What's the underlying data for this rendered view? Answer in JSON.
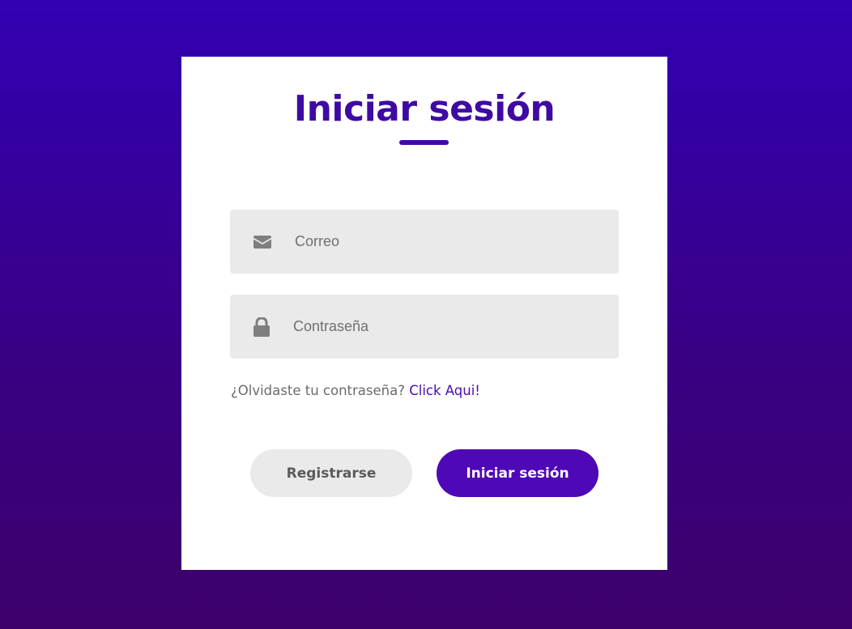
{
  "card": {
    "title": "Iniciar sesión",
    "email": {
      "placeholder": "Correo",
      "icon": "envelope-icon"
    },
    "password": {
      "placeholder": "Contraseña",
      "icon": "lock-icon"
    },
    "forgot": {
      "text": "¿Olvidaste tu contraseña?",
      "link": "Click Aqui!"
    },
    "buttons": {
      "register": "Registrarse",
      "login": "Iniciar sesión"
    }
  },
  "colors": {
    "accent": "#4f08b6",
    "title": "#3f0aa3",
    "field_bg": "#eaeaea",
    "background_top": "#3300b3",
    "background_bottom": "#3d006b"
  }
}
